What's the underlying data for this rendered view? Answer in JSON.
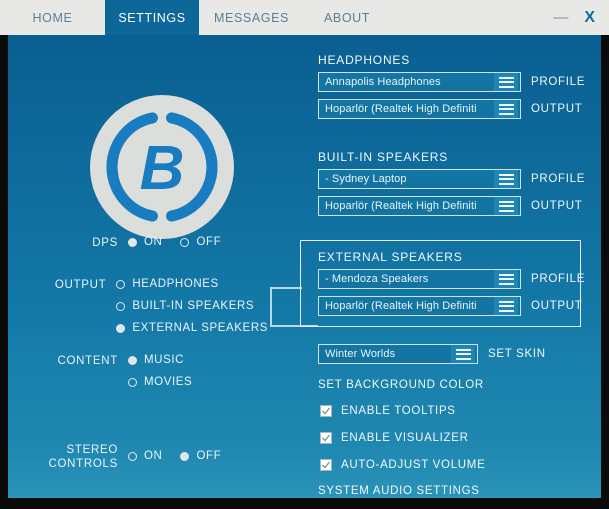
{
  "window": {
    "minimize_label": "—",
    "close_label": "X"
  },
  "tabs": [
    {
      "label": "HOME",
      "active": false
    },
    {
      "label": "SETTINGS",
      "active": true
    },
    {
      "label": "MESSAGES",
      "active": false
    },
    {
      "label": "ABOUT",
      "active": false
    }
  ],
  "logo": {
    "letter": "B"
  },
  "left_controls": {
    "dps": {
      "label": "DPS",
      "options": [
        {
          "label": "ON",
          "selected": true
        },
        {
          "label": "OFF",
          "selected": false
        }
      ]
    },
    "output": {
      "label": "OUTPUT",
      "options": [
        {
          "label": "HEADPHONES",
          "selected": false
        },
        {
          "label": "BUILT-IN SPEAKERS",
          "selected": false
        },
        {
          "label": "EXTERNAL SPEAKERS",
          "selected": true
        }
      ]
    },
    "content": {
      "label": "CONTENT",
      "options": [
        {
          "label": "MUSIC",
          "selected": true
        },
        {
          "label": "MOVIES",
          "selected": false
        }
      ]
    },
    "stereo": {
      "label_line1": "STEREO",
      "label_line2": "CONTROLS",
      "options": [
        {
          "label": "ON",
          "selected": false
        },
        {
          "label": "OFF",
          "selected": true
        }
      ]
    }
  },
  "device_sections": [
    {
      "heading": "HEADPHONES",
      "profile": {
        "value": "Annapolis Headphones",
        "label": "PROFILE"
      },
      "output": {
        "value": "Hoparlör (Realtek High Definiti",
        "label": "OUTPUT"
      }
    },
    {
      "heading": "BUILT-IN SPEAKERS",
      "profile": {
        "value": "- Sydney Laptop",
        "label": "PROFILE"
      },
      "output": {
        "value": "Hoparlör (Realtek High Definiti",
        "label": "OUTPUT"
      }
    },
    {
      "heading": "EXTERNAL SPEAKERS",
      "profile": {
        "value": "- Mendoza Speakers",
        "label": "PROFILE"
      },
      "output": {
        "value": "Hoparlör (Realtek High Definiti",
        "label": "OUTPUT"
      },
      "highlighted": true
    }
  ],
  "skin": {
    "value": "Winter Worlds",
    "label": "SET SKIN"
  },
  "background_color_link": "SET BACKGROUND COLOR",
  "checkboxes": [
    {
      "label": "ENABLE TOOLTIPS",
      "checked": true
    },
    {
      "label": "ENABLE VISUALIZER",
      "checked": true
    },
    {
      "label": "AUTO-ADJUST VOLUME",
      "checked": true
    }
  ],
  "system_audio_link": "SYSTEM AUDIO SETTINGS",
  "colors": {
    "accent": "#0d6799",
    "tabbar_bg": "#e8e8e6",
    "panel_top": "#0a5f91",
    "panel_bottom": "#2a93b8",
    "text": "#f2f8fb"
  }
}
